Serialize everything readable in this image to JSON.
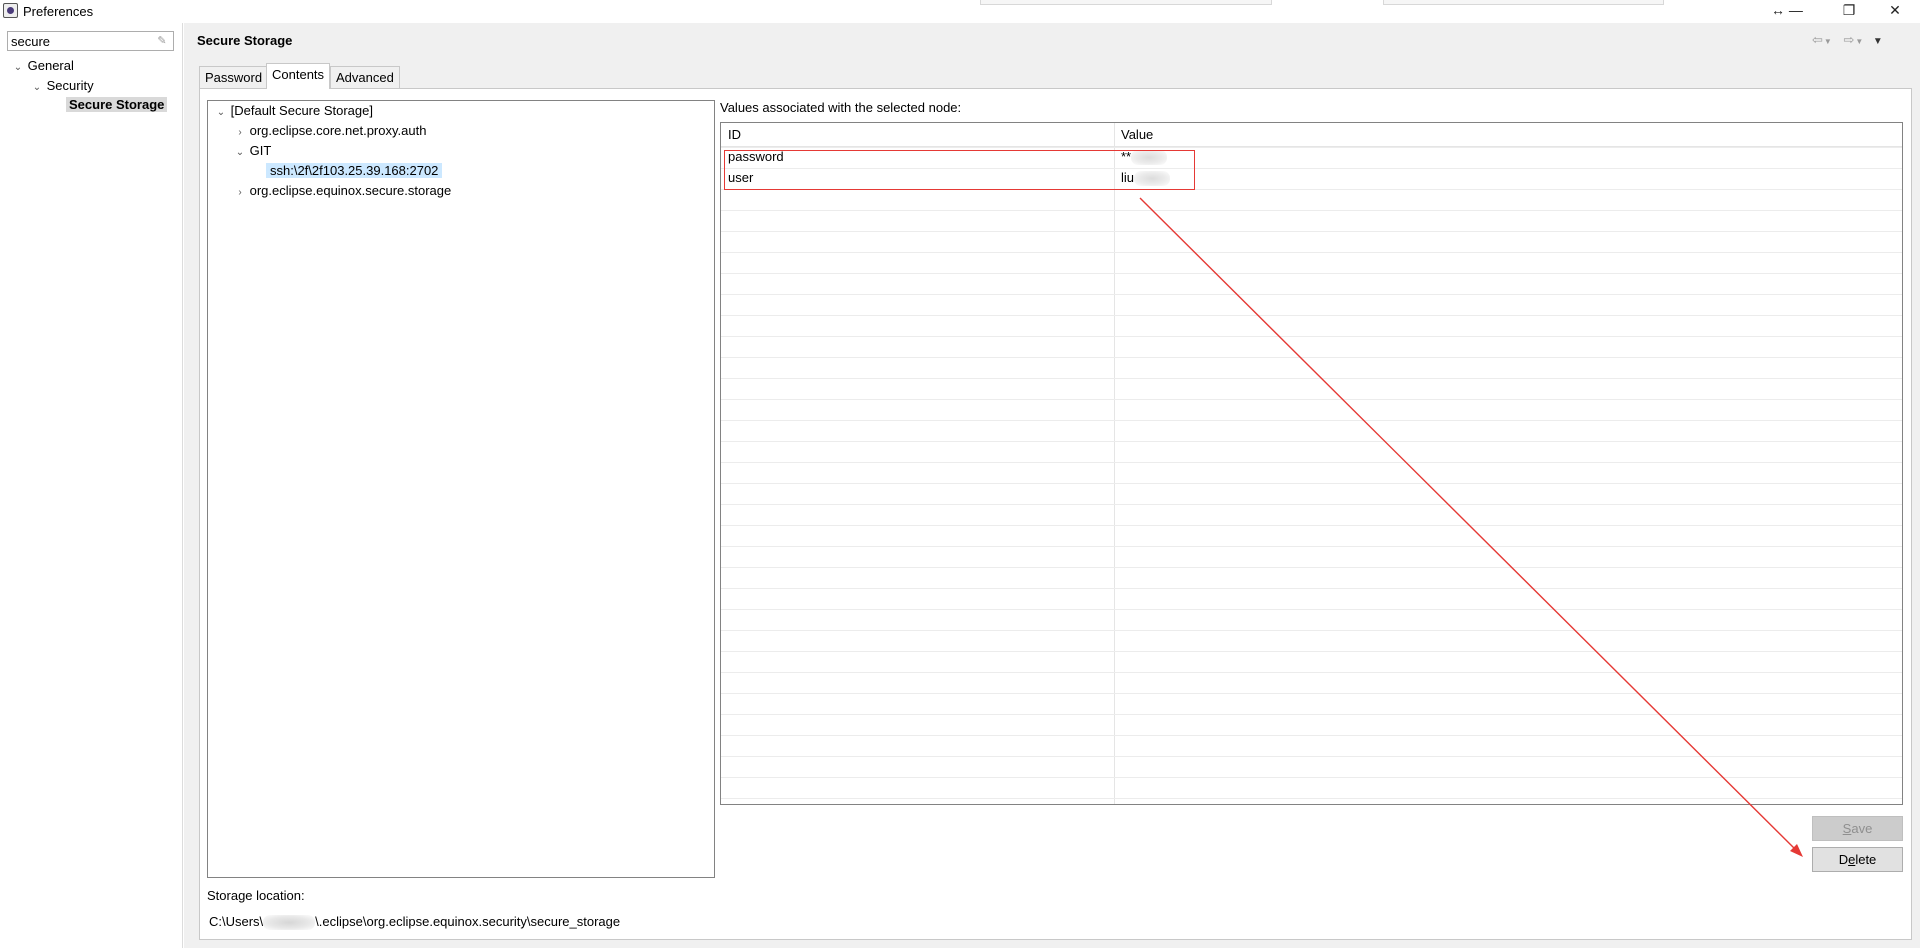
{
  "window": {
    "title": "Preferences",
    "controls": {
      "resize": "↔ —",
      "restore": "❐",
      "close": "✕"
    }
  },
  "sidebar": {
    "filter_value": "secure",
    "tree": [
      {
        "label": "General",
        "expanded": true
      },
      {
        "label": "Security",
        "expanded": true
      },
      {
        "label": "Secure Storage",
        "selected": true
      }
    ]
  },
  "page": {
    "title": "Secure Storage",
    "nav_icons": [
      "back-icon",
      "back-menu-icon",
      "forward-icon",
      "forward-menu-icon",
      "view-menu-icon"
    ]
  },
  "tabs": [
    {
      "label": "Password",
      "active": false
    },
    {
      "label": "Contents",
      "active": true
    },
    {
      "label": "Advanced",
      "active": false
    }
  ],
  "storage_tree": {
    "root": "[Default Secure Storage]",
    "nodes": [
      {
        "label": "org.eclipse.core.net.proxy.auth",
        "expanded": false
      },
      {
        "label": "GIT",
        "expanded": true
      },
      {
        "label": "ssh:\\2f\\2f103.25.39.168:2702",
        "selected": true
      },
      {
        "label": "org.eclipse.equinox.secure.storage",
        "expanded": false
      }
    ]
  },
  "values": {
    "label": "Values associated with the selected node:",
    "columns": [
      "ID",
      "Value"
    ],
    "rows": [
      {
        "id": "password",
        "value": "**"
      },
      {
        "id": "user",
        "value": "liu"
      }
    ]
  },
  "buttons": {
    "save": {
      "label": "Save",
      "mnemonic": "S",
      "rest": "ave",
      "enabled": false
    },
    "delete": {
      "label": "Delete",
      "mnemonic_prefix": "D",
      "mnemonic": "e",
      "rest": "lete",
      "enabled": true
    }
  },
  "storage_location": {
    "label": "Storage location:",
    "path_prefix": "C:\\Users\\",
    "path_suffix": "\\.eclipse\\org.eclipse.equinox.security\\secure_storage"
  },
  "annotations": {
    "color": "#e53935"
  }
}
